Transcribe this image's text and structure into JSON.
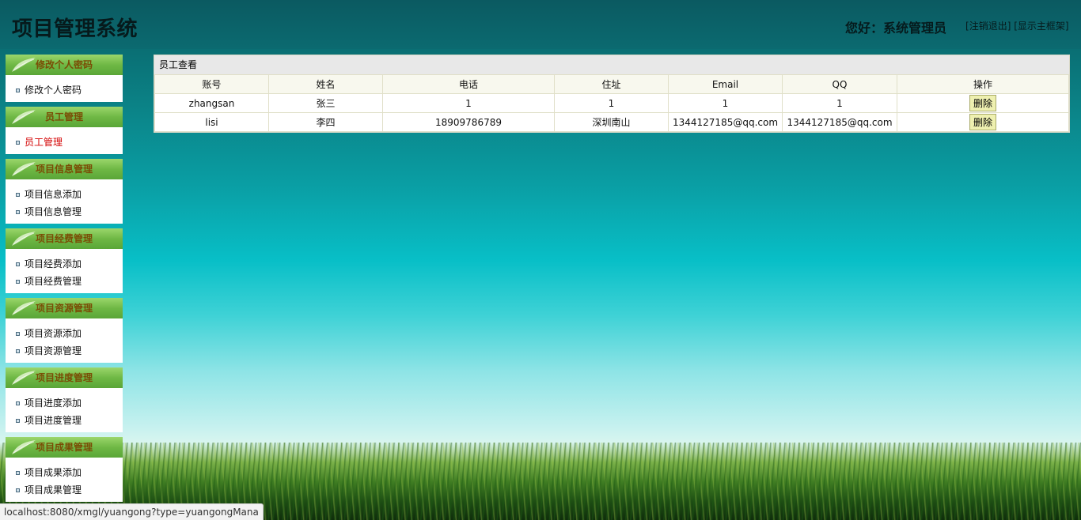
{
  "header": {
    "app_title": "项目管理系统",
    "greeting": "您好：系统管理员",
    "logout_label": "注销退出",
    "show_frame_label": "显示主框架"
  },
  "sidebar": {
    "groups": [
      {
        "title": "修改个人密码",
        "items": [
          {
            "label": "修改个人密码"
          }
        ]
      },
      {
        "title": "员工管理",
        "items": [
          {
            "label": "员工管理",
            "active": true
          }
        ]
      },
      {
        "title": "项目信息管理",
        "items": [
          {
            "label": "项目信息添加"
          },
          {
            "label": "项目信息管理"
          }
        ]
      },
      {
        "title": "项目经费管理",
        "items": [
          {
            "label": "项目经费添加"
          },
          {
            "label": "项目经费管理"
          }
        ]
      },
      {
        "title": "项目资源管理",
        "items": [
          {
            "label": "项目资源添加"
          },
          {
            "label": "项目资源管理"
          }
        ]
      },
      {
        "title": "项目进度管理",
        "items": [
          {
            "label": "项目进度添加"
          },
          {
            "label": "项目进度管理"
          }
        ]
      },
      {
        "title": "项目成果管理",
        "items": [
          {
            "label": "项目成果添加"
          },
          {
            "label": "项目成果管理"
          }
        ]
      }
    ]
  },
  "main": {
    "panel_title": "员工查看",
    "columns": [
      "账号",
      "姓名",
      "电话",
      "住址",
      "Email",
      "QQ",
      "操作"
    ],
    "rows": [
      [
        "zhangsan",
        "张三",
        "1",
        "1",
        "1",
        "1"
      ],
      [
        "lisi",
        "李四",
        "18909786789",
        "深圳南山",
        "1344127185@qq.com",
        "1344127185@qq.com"
      ]
    ],
    "delete_label": "删除"
  },
  "statusbar": {
    "url": "localhost:8080/xmgl/yuangong?type=yuangongMana"
  },
  "colors": {
    "menu_head_text": "#7a4d05",
    "active_item": "#d40000"
  }
}
